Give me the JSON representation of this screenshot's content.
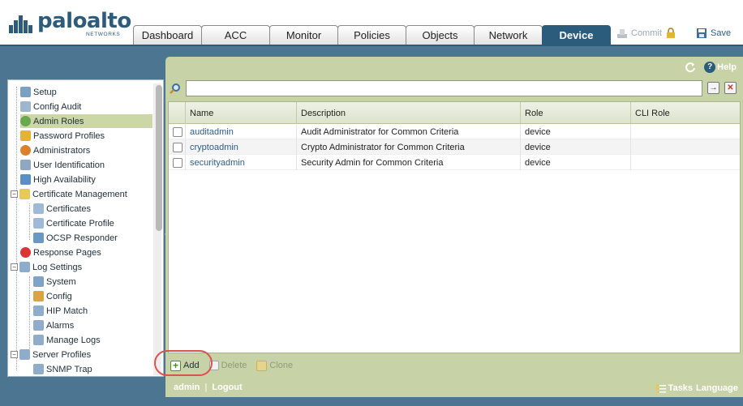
{
  "brand": {
    "name": "paloalto",
    "subtitle": "NETWORKS"
  },
  "tabs": [
    "Dashboard",
    "ACC",
    "Monitor",
    "Policies",
    "Objects",
    "Network",
    "Device"
  ],
  "active_tab": "Device",
  "header_actions": {
    "commit": "Commit",
    "save": "Save"
  },
  "panel": {
    "refresh_icon": "refresh-icon",
    "help": "Help"
  },
  "nav": {
    "selected": "Admin Roles",
    "items": [
      {
        "label": "Setup",
        "icon": "setup-icon"
      },
      {
        "label": "Config Audit",
        "icon": "config-audit-icon"
      },
      {
        "label": "Admin Roles",
        "icon": "admin-roles-icon"
      },
      {
        "label": "Password Profiles",
        "icon": "password-profiles-icon"
      },
      {
        "label": "Administrators",
        "icon": "administrators-icon"
      },
      {
        "label": "User Identification",
        "icon": "user-identification-icon"
      },
      {
        "label": "High Availability",
        "icon": "high-availability-icon"
      },
      {
        "label": "Certificate Management",
        "icon": "certificate-management-icon"
      },
      {
        "label": "Certificates",
        "icon": "certificates-icon"
      },
      {
        "label": "Certificate Profile",
        "icon": "certificate-profile-icon"
      },
      {
        "label": "OCSP Responder",
        "icon": "ocsp-responder-icon"
      },
      {
        "label": "Response Pages",
        "icon": "response-pages-icon"
      },
      {
        "label": "Log Settings",
        "icon": "log-settings-icon"
      },
      {
        "label": "System",
        "icon": "system-icon"
      },
      {
        "label": "Config",
        "icon": "config-icon"
      },
      {
        "label": "HIP Match",
        "icon": "hip-match-icon"
      },
      {
        "label": "Alarms",
        "icon": "alarms-icon"
      },
      {
        "label": "Manage Logs",
        "icon": "manage-logs-icon"
      },
      {
        "label": "Server Profiles",
        "icon": "server-profiles-icon"
      },
      {
        "label": "SNMP Trap",
        "icon": "snmp-trap-icon"
      }
    ]
  },
  "filter": {
    "value": "",
    "placeholder": ""
  },
  "table": {
    "columns": [
      "",
      "Name",
      "Description",
      "Role",
      "CLI Role"
    ],
    "rows": [
      {
        "name": "auditadmin",
        "description": "Audit Administrator for Common Criteria",
        "role": "device",
        "cli_role": ""
      },
      {
        "name": "cryptoadmin",
        "description": "Crypto Administrator for Common Criteria",
        "role": "device",
        "cli_role": ""
      },
      {
        "name": "securityadmin",
        "description": "Security Admin for Common Criteria",
        "role": "device",
        "cli_role": ""
      }
    ]
  },
  "actions": {
    "add": "Add",
    "delete": "Delete",
    "clone": "Clone"
  },
  "footer": {
    "user": "admin",
    "separator": "|",
    "logout": "Logout",
    "tasks": "Tasks",
    "language": "Language"
  },
  "colors": {
    "accent": "#2c5c7c",
    "band": "#4b7591",
    "panel": "#c7d3a7",
    "highlight": "#d9534f"
  }
}
